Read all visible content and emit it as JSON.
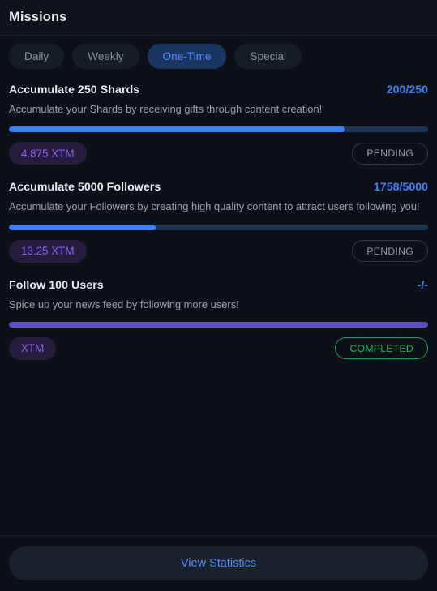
{
  "header": {
    "title": "Missions"
  },
  "tabs": [
    {
      "label": "Daily",
      "active": false
    },
    {
      "label": "Weekly",
      "active": false
    },
    {
      "label": "One-Time",
      "active": true
    },
    {
      "label": "Special",
      "active": false
    }
  ],
  "missions": [
    {
      "title": "Accumulate 250 Shards",
      "counter": "200/250",
      "description": "Accumulate your Shards by receiving gifts through content creation!",
      "progress_percent": 80,
      "progress_color": "#3b82f6",
      "reward": "4.875 XTM",
      "status": "PENDING",
      "status_state": "pending"
    },
    {
      "title": "Accumulate 5000 Followers",
      "counter": "1758/5000",
      "description": "Accumulate your Followers by creating high quality content to attract users following you!",
      "progress_percent": 35,
      "progress_color": "#3b82f6",
      "reward": "13.25 XTM",
      "status": "PENDING",
      "status_state": "pending"
    },
    {
      "title": "Follow 100 Users",
      "counter": "-/-",
      "description": "Spice up your news feed by following more users!",
      "progress_percent": 100,
      "progress_color": "#5b50c4",
      "reward": "XTM",
      "status": "COMPLETED",
      "status_state": "completed"
    }
  ],
  "footer": {
    "view_statistics_label": "View Statistics"
  },
  "colors": {
    "background": "#0d1117",
    "accent_blue": "#3b82f6",
    "accent_purple": "#5b50c4",
    "status_completed": "#1db563",
    "status_pending": "#9299a3"
  }
}
